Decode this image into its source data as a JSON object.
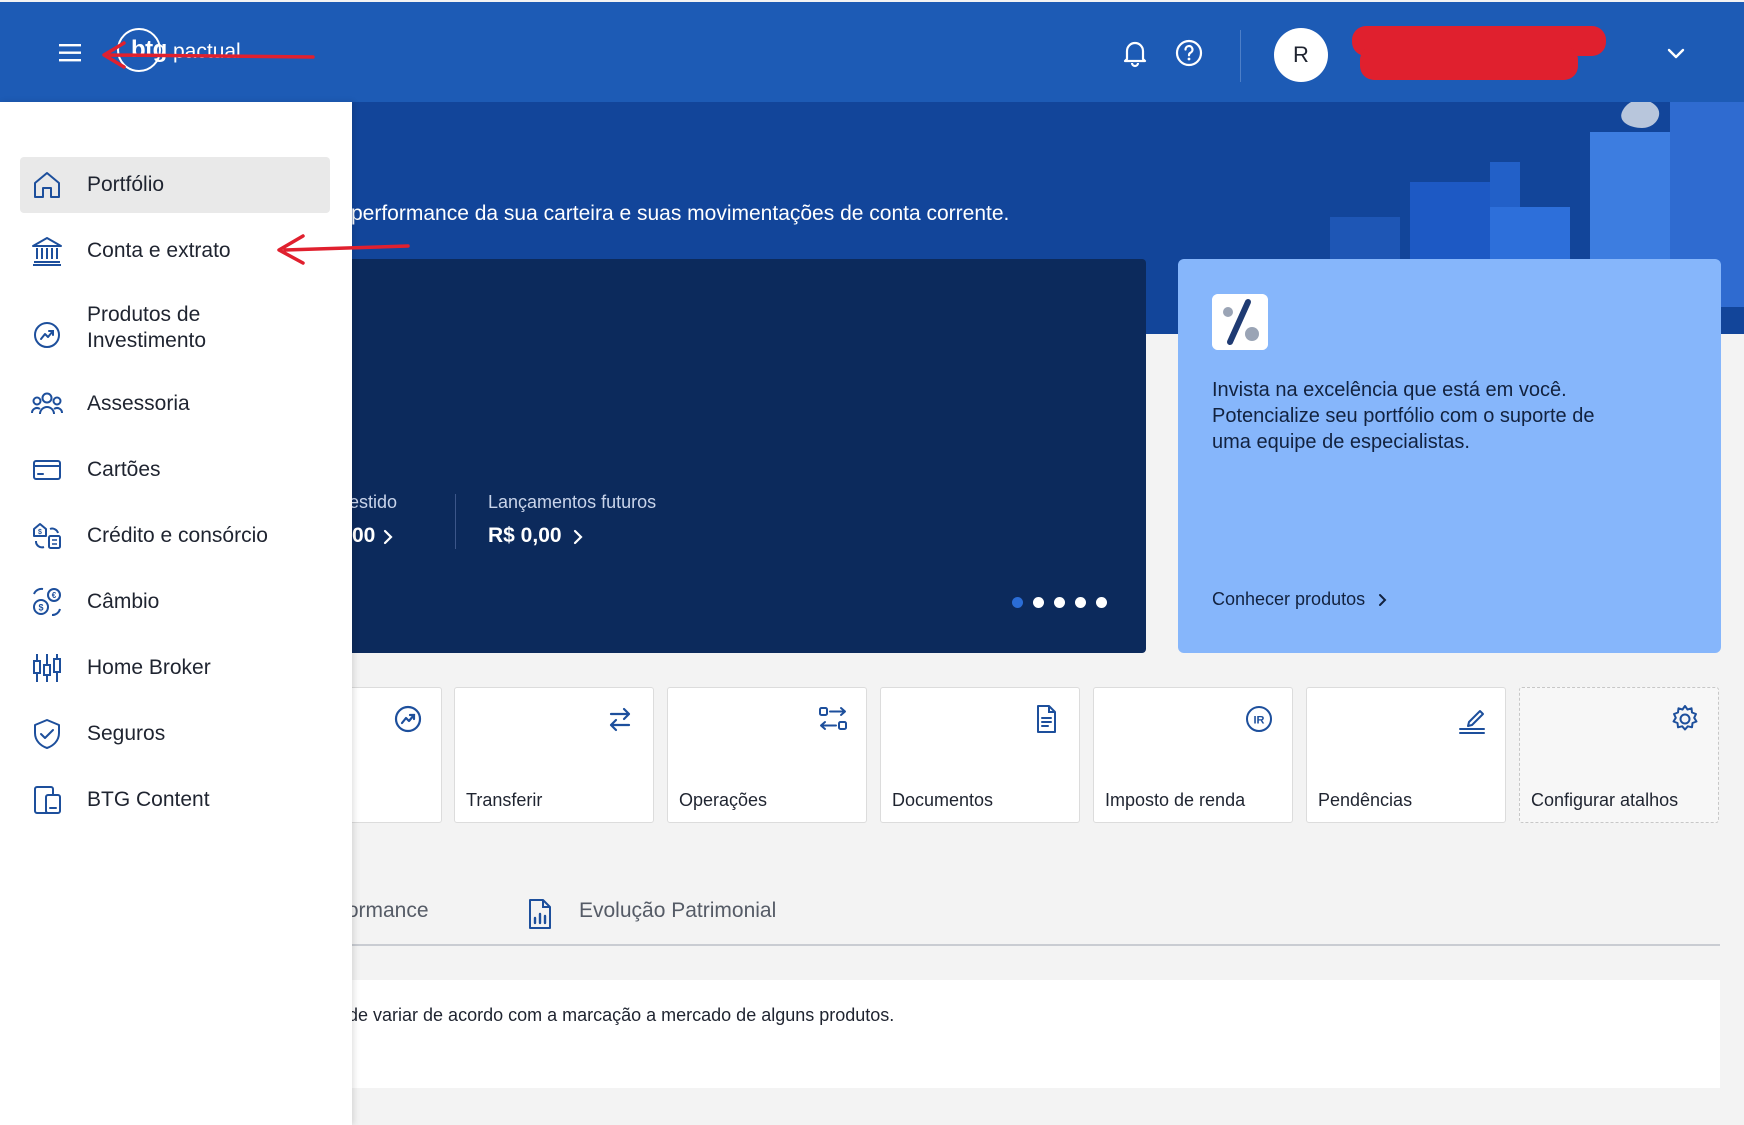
{
  "header": {
    "menu_icon": "hamburger-menu-icon",
    "logo": {
      "brand": "btg",
      "suffix": "pactual"
    },
    "notifications_icon": "bell-icon",
    "help_icon": "help-circle-icon",
    "avatar_initial": "R",
    "user_menu_icon": "chevron-down-icon",
    "brand_color": "#1d5bb5"
  },
  "hero": {
    "subtitle": "performance da sua carteira e suas movimentações de conta corrente."
  },
  "balance_card": {
    "invested_label": "nvestido",
    "invested_value": "00",
    "future_label": "Lançamentos futuros",
    "future_value": "R$ 0,00",
    "carousel": {
      "count": 5,
      "active_index": 0
    }
  },
  "promo_card": {
    "text": "Invista na excelência que está em você.\nPotencialize seu portfólio com o suporte de\numa equipe de especialistas.",
    "link": "Conhecer produtos",
    "color": "#86b6fb"
  },
  "shortcuts": [
    {
      "label": "",
      "icon": "investment-icon"
    },
    {
      "label": "Transferir",
      "icon": "transfer-arrows-icon"
    },
    {
      "label": "Operações",
      "icon": "operations-icon"
    },
    {
      "label": "Documentos",
      "icon": "document-icon"
    },
    {
      "label": "Imposto de renda",
      "icon": "ir-tax-icon"
    },
    {
      "label": "Pendências",
      "icon": "pending-sign-icon"
    },
    {
      "label": "Configurar atalhos",
      "icon": "gear-icon"
    }
  ],
  "tabs": {
    "performance": "rformance",
    "evolution": "Evolução Patrimonial"
  },
  "info": {
    "text": "de variar de acordo com a marcação a mercado de alguns produtos."
  },
  "sidebar": {
    "items": [
      {
        "label": "Portfólio",
        "icon": "home-icon",
        "active": true
      },
      {
        "label": "Conta e extrato",
        "icon": "bank-icon",
        "active": false
      },
      {
        "label": "Produtos de\nInvestimento",
        "icon": "investment-icon",
        "active": false
      },
      {
        "label": "Assessoria",
        "icon": "people-icon",
        "active": false
      },
      {
        "label": "Cartões",
        "icon": "card-icon",
        "active": false
      },
      {
        "label": "Crédito e consórcio",
        "icon": "credit-icon",
        "active": false
      },
      {
        "label": "Câmbio",
        "icon": "exchange-icon",
        "active": false
      },
      {
        "label": "Home Broker",
        "icon": "candlestick-icon",
        "active": false
      },
      {
        "label": "Seguros",
        "icon": "shield-icon",
        "active": false
      },
      {
        "label": "BTG Content",
        "icon": "content-devices-icon",
        "active": false
      }
    ]
  },
  "annotations": {
    "arrow_color": "#e0202e"
  }
}
